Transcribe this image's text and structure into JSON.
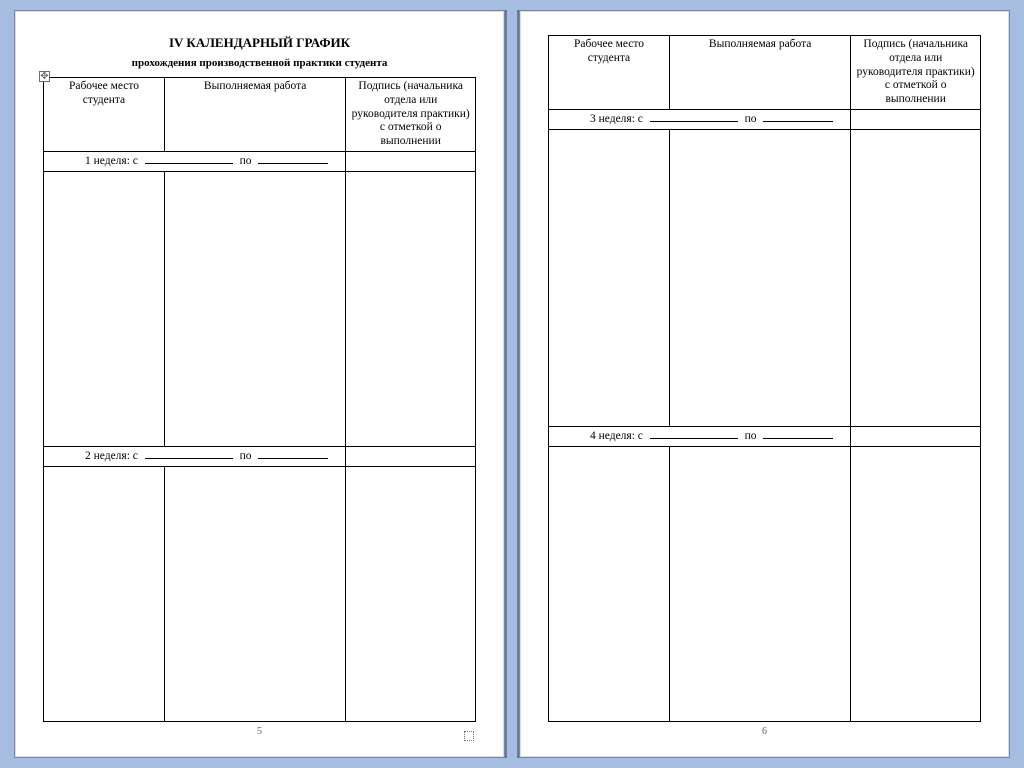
{
  "doc": {
    "title": "IV КАЛЕНДАРНЫЙ ГРАФИК",
    "subtitle": "прохождения производственной практики студента",
    "headers": {
      "col_a": "Рабочее место студента",
      "col_b": "Выполняемая работа",
      "col_c": "Подпись (начальника отдела или руководителя практики) с отметкой о выполнении"
    },
    "weeks": {
      "w1_label": "1 неделя: с",
      "w1_to": "по",
      "w2_label": "2 неделя: с",
      "w2_to": "по",
      "w3_label": "3 неделя: с",
      "w3_to": "по",
      "w4_label": "4 неделя: с",
      "w4_to": "по"
    },
    "page_numbers": {
      "left": "5",
      "right": "6"
    },
    "anchor_glyph": "✥"
  }
}
